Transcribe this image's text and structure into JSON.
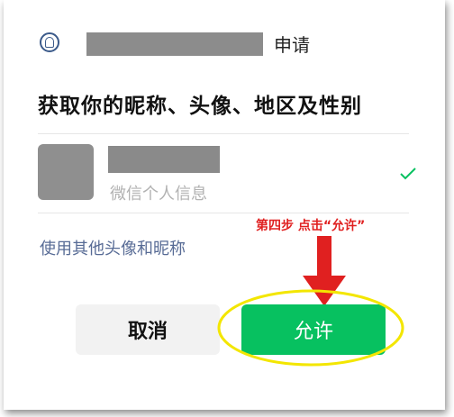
{
  "dialog": {
    "request_label": "申请",
    "permission_title": "获取你的昵称、头像、地区及性别",
    "account_subtitle": "微信个人信息",
    "other_avatar_link": "使用其他头像和昵称",
    "cancel_label": "取消",
    "allow_label": "允许"
  },
  "annotation": {
    "step_note": "第四步 点击“允许”"
  },
  "colors": {
    "allow_green": "#07c160",
    "link_blue": "#576b95",
    "annotation_red": "#e02020",
    "highlight_yellow": "#f3e600",
    "check_green": "#07c160"
  },
  "icons": {
    "app_logo": "app-logo-icon",
    "selected": "checkmark-icon",
    "pointer": "red-arrow-icon"
  }
}
